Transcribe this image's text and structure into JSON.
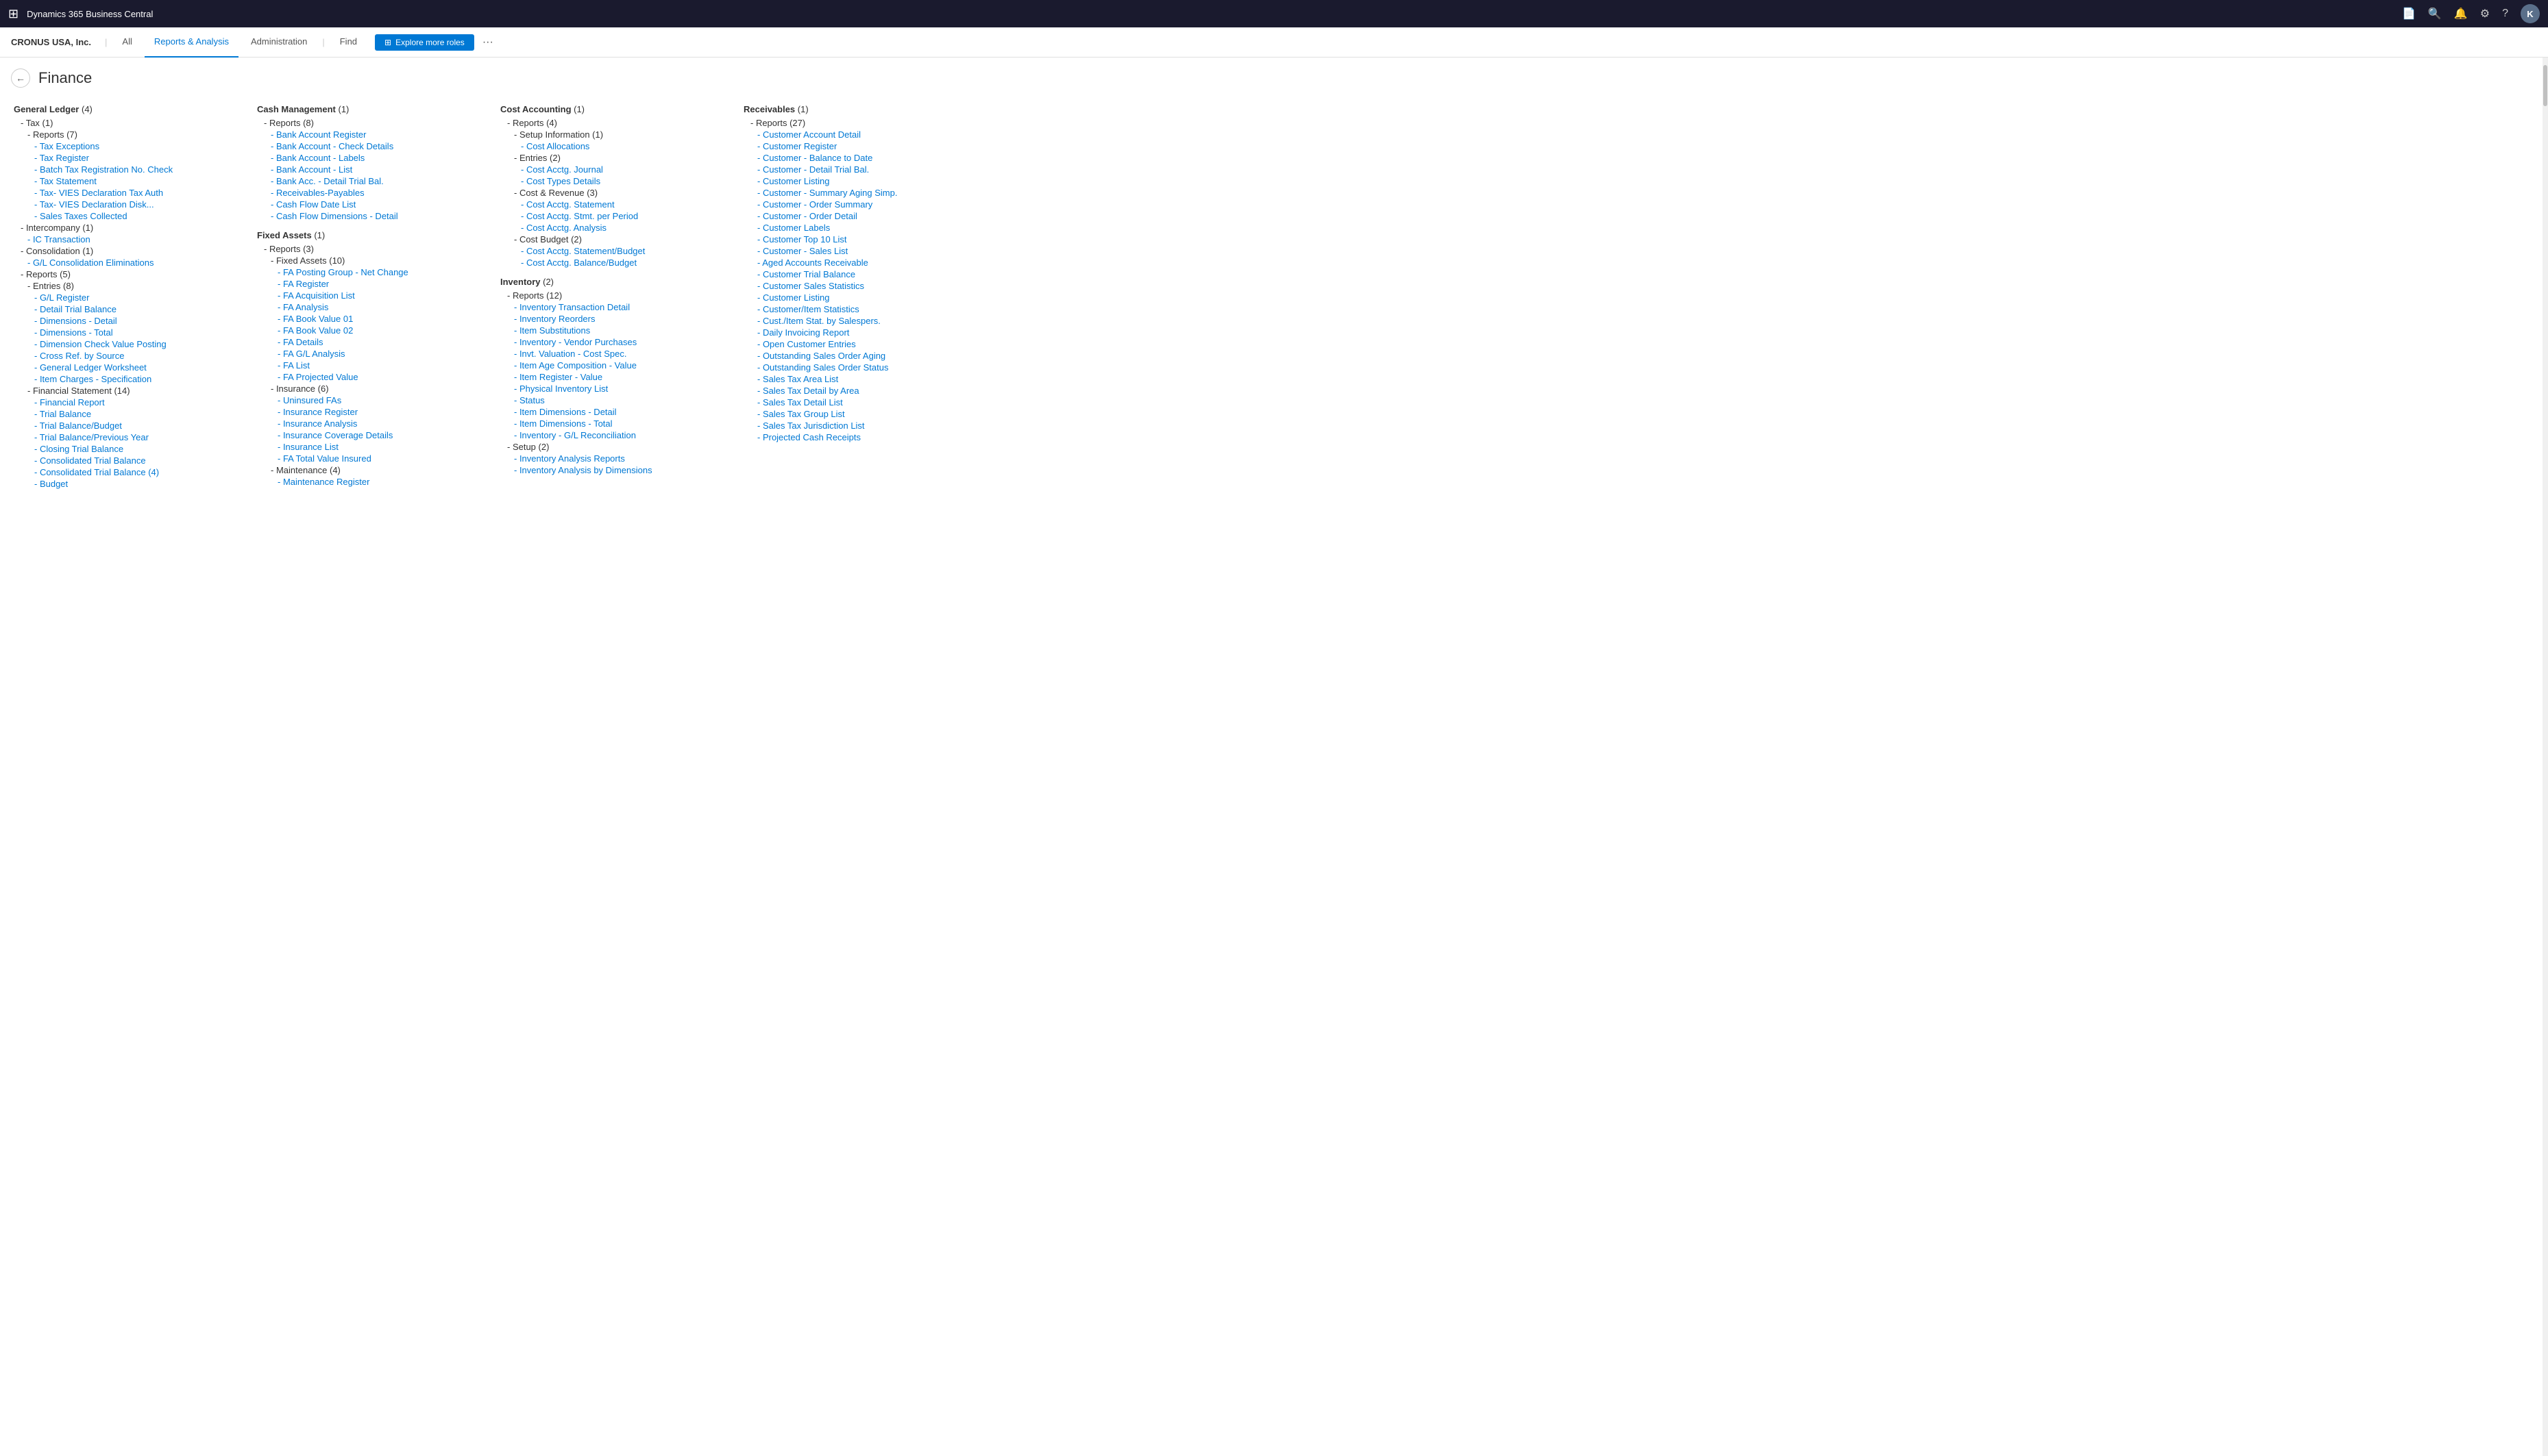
{
  "app": {
    "title": "Dynamics 365 Business Central",
    "avatar_initials": "K"
  },
  "company": "CRONUS USA, Inc.",
  "nav_tabs": [
    {
      "label": "All",
      "active": false
    },
    {
      "label": "Reports & Analysis",
      "active": true
    },
    {
      "label": "Administration",
      "active": false
    },
    {
      "label": "Find",
      "active": false
    }
  ],
  "explore_btn": "Explore more roles",
  "page_title": "Finance",
  "columns": [
    {
      "id": "col1",
      "sections": [
        {
          "header": "General Ledger",
          "count": "(4)",
          "items": [
            {
              "type": "plain",
              "indent": 1,
              "text": "- Tax (1)"
            },
            {
              "type": "plain",
              "indent": 2,
              "text": "- Reports (7)"
            },
            {
              "type": "link",
              "indent": 3,
              "text": "- Tax Exceptions"
            },
            {
              "type": "link",
              "indent": 3,
              "text": "- Tax Register"
            },
            {
              "type": "link",
              "indent": 3,
              "text": "- Batch Tax Registration No. Check"
            },
            {
              "type": "link",
              "indent": 3,
              "text": "- Tax Statement"
            },
            {
              "type": "link",
              "indent": 3,
              "text": "- Tax- VIES Declaration Tax Auth"
            },
            {
              "type": "link",
              "indent": 3,
              "text": "- Tax- VIES Declaration Disk..."
            },
            {
              "type": "link",
              "indent": 3,
              "text": "- Sales Taxes Collected"
            },
            {
              "type": "plain",
              "indent": 1,
              "text": "- Intercompany (1)"
            },
            {
              "type": "link",
              "indent": 2,
              "text": "- IC Transaction"
            },
            {
              "type": "plain",
              "indent": 1,
              "text": "- Consolidation (1)"
            },
            {
              "type": "link",
              "indent": 2,
              "text": "- G/L Consolidation Eliminations"
            },
            {
              "type": "plain",
              "indent": 1,
              "text": "- Reports (5)"
            },
            {
              "type": "plain",
              "indent": 2,
              "text": "- Entries (8)"
            },
            {
              "type": "link",
              "indent": 3,
              "text": "- G/L Register"
            },
            {
              "type": "link",
              "indent": 3,
              "text": "- Detail Trial Balance"
            },
            {
              "type": "link",
              "indent": 3,
              "text": "- Dimensions - Detail"
            },
            {
              "type": "link",
              "indent": 3,
              "text": "- Dimensions - Total"
            },
            {
              "type": "link",
              "indent": 3,
              "text": "- Dimension Check Value Posting"
            },
            {
              "type": "link",
              "indent": 3,
              "text": "- Cross Ref. by Source"
            },
            {
              "type": "link",
              "indent": 3,
              "text": "- General Ledger Worksheet"
            },
            {
              "type": "link",
              "indent": 3,
              "text": "- Item Charges - Specification"
            },
            {
              "type": "plain",
              "indent": 2,
              "text": "- Financial Statement (14)"
            },
            {
              "type": "link",
              "indent": 3,
              "text": "- Financial Report"
            },
            {
              "type": "link",
              "indent": 3,
              "text": "- Trial Balance"
            },
            {
              "type": "link",
              "indent": 3,
              "text": "- Trial Balance/Budget"
            },
            {
              "type": "link",
              "indent": 3,
              "text": "- Trial Balance/Previous Year"
            },
            {
              "type": "link",
              "indent": 3,
              "text": "- Closing Trial Balance"
            },
            {
              "type": "link",
              "indent": 3,
              "text": "- Consolidated Trial Balance"
            },
            {
              "type": "link",
              "indent": 3,
              "text": "- Consolidated Trial Balance (4)"
            },
            {
              "type": "link",
              "indent": 3,
              "text": "- Budget"
            }
          ]
        }
      ]
    },
    {
      "id": "col2",
      "sections": [
        {
          "header": "Cash Management",
          "count": "(1)",
          "items": [
            {
              "type": "plain",
              "indent": 1,
              "text": "- Reports (8)"
            },
            {
              "type": "link",
              "indent": 2,
              "text": "- Bank Account Register"
            },
            {
              "type": "link",
              "indent": 2,
              "text": "- Bank Account - Check Details"
            },
            {
              "type": "link",
              "indent": 2,
              "text": "- Bank Account - Labels"
            },
            {
              "type": "link",
              "indent": 2,
              "text": "- Bank Account - List"
            },
            {
              "type": "link",
              "indent": 2,
              "text": "- Bank Acc. - Detail Trial Bal."
            },
            {
              "type": "link",
              "indent": 2,
              "text": "- Receivables-Payables"
            },
            {
              "type": "link",
              "indent": 2,
              "text": "- Cash Flow Date List"
            },
            {
              "type": "link",
              "indent": 2,
              "text": "- Cash Flow Dimensions - Detail"
            }
          ]
        },
        {
          "header": "Fixed Assets",
          "count": "(1)",
          "items": [
            {
              "type": "plain",
              "indent": 1,
              "text": "- Reports (3)"
            },
            {
              "type": "plain",
              "indent": 2,
              "text": "- Fixed Assets (10)"
            },
            {
              "type": "link",
              "indent": 3,
              "text": "- FA Posting Group - Net Change"
            },
            {
              "type": "link",
              "indent": 3,
              "text": "- FA Register"
            },
            {
              "type": "link",
              "indent": 3,
              "text": "- FA Acquisition List"
            },
            {
              "type": "link",
              "indent": 3,
              "text": "- FA Analysis"
            },
            {
              "type": "link",
              "indent": 3,
              "text": "- FA Book Value 01"
            },
            {
              "type": "link",
              "indent": 3,
              "text": "- FA Book Value 02"
            },
            {
              "type": "link",
              "indent": 3,
              "text": "- FA Details"
            },
            {
              "type": "link",
              "indent": 3,
              "text": "- FA G/L Analysis"
            },
            {
              "type": "link",
              "indent": 3,
              "text": "- FA List"
            },
            {
              "type": "link",
              "indent": 3,
              "text": "- FA Projected Value"
            },
            {
              "type": "plain",
              "indent": 2,
              "text": "- Insurance (6)"
            },
            {
              "type": "link",
              "indent": 3,
              "text": "- Uninsured FAs"
            },
            {
              "type": "link",
              "indent": 3,
              "text": "- Insurance Register"
            },
            {
              "type": "link",
              "indent": 3,
              "text": "- Insurance Analysis"
            },
            {
              "type": "link",
              "indent": 3,
              "text": "- Insurance Coverage Details"
            },
            {
              "type": "link",
              "indent": 3,
              "text": "- Insurance List"
            },
            {
              "type": "link",
              "indent": 3,
              "text": "- FA Total Value Insured"
            },
            {
              "type": "plain",
              "indent": 2,
              "text": "- Maintenance (4)"
            },
            {
              "type": "link",
              "indent": 3,
              "text": "- Maintenance Register"
            }
          ]
        }
      ]
    },
    {
      "id": "col3",
      "sections": [
        {
          "header": "Cost Accounting",
          "count": "(1)",
          "items": [
            {
              "type": "plain",
              "indent": 1,
              "text": "- Reports (4)"
            },
            {
              "type": "plain",
              "indent": 2,
              "text": "- Setup Information (1)"
            },
            {
              "type": "link",
              "indent": 3,
              "text": "- Cost Allocations"
            },
            {
              "type": "plain",
              "indent": 2,
              "text": "- Entries (2)"
            },
            {
              "type": "link",
              "indent": 3,
              "text": "- Cost Acctg. Journal"
            },
            {
              "type": "link",
              "indent": 3,
              "text": "- Cost Types Details"
            },
            {
              "type": "plain",
              "indent": 2,
              "text": "- Cost & Revenue (3)"
            },
            {
              "type": "link",
              "indent": 3,
              "text": "- Cost Acctg. Statement"
            },
            {
              "type": "link",
              "indent": 3,
              "text": "- Cost Acctg. Stmt. per Period"
            },
            {
              "type": "link",
              "indent": 3,
              "text": "- Cost Acctg. Analysis"
            },
            {
              "type": "plain",
              "indent": 2,
              "text": "- Cost Budget (2)"
            },
            {
              "type": "link",
              "indent": 3,
              "text": "- Cost Acctg. Statement/Budget"
            },
            {
              "type": "link",
              "indent": 3,
              "text": "- Cost Acctg. Balance/Budget"
            }
          ]
        },
        {
          "header": "Inventory",
          "count": "(2)",
          "items": [
            {
              "type": "plain",
              "indent": 1,
              "text": "- Reports (12)"
            },
            {
              "type": "link",
              "indent": 2,
              "text": "- Inventory Transaction Detail"
            },
            {
              "type": "link",
              "indent": 2,
              "text": "- Inventory Reorders"
            },
            {
              "type": "link",
              "indent": 2,
              "text": "- Item Substitutions"
            },
            {
              "type": "link",
              "indent": 2,
              "text": "- Inventory - Vendor Purchases"
            },
            {
              "type": "link",
              "indent": 2,
              "text": "- Invt. Valuation - Cost Spec."
            },
            {
              "type": "link",
              "indent": 2,
              "text": "- Item Age Composition - Value"
            },
            {
              "type": "link",
              "indent": 2,
              "text": "- Item Register - Value"
            },
            {
              "type": "link",
              "indent": 2,
              "text": "- Physical Inventory List"
            },
            {
              "type": "link",
              "indent": 2,
              "text": "- Status"
            },
            {
              "type": "link",
              "indent": 2,
              "text": "- Item Dimensions - Detail"
            },
            {
              "type": "link",
              "indent": 2,
              "text": "- Item Dimensions - Total"
            },
            {
              "type": "link",
              "indent": 2,
              "text": "- Inventory - G/L Reconciliation"
            },
            {
              "type": "plain",
              "indent": 1,
              "text": "- Setup (2)"
            },
            {
              "type": "link",
              "indent": 2,
              "text": "- Inventory Analysis Reports"
            },
            {
              "type": "link",
              "indent": 2,
              "text": "- Inventory Analysis by Dimensions"
            }
          ]
        }
      ]
    },
    {
      "id": "col4",
      "sections": [
        {
          "header": "Receivables",
          "count": "(1)",
          "items": [
            {
              "type": "plain",
              "indent": 1,
              "text": "- Reports (27)"
            },
            {
              "type": "link",
              "indent": 2,
              "text": "- Customer Account Detail"
            },
            {
              "type": "link",
              "indent": 2,
              "text": "- Customer Register"
            },
            {
              "type": "link",
              "indent": 2,
              "text": "- Customer - Balance to Date"
            },
            {
              "type": "link",
              "indent": 2,
              "text": "- Customer - Detail Trial Bal."
            },
            {
              "type": "link",
              "indent": 2,
              "text": "- Customer Listing"
            },
            {
              "type": "link",
              "indent": 2,
              "text": "- Customer - Summary Aging Simp."
            },
            {
              "type": "link",
              "indent": 2,
              "text": "- Customer - Order Summary"
            },
            {
              "type": "link",
              "indent": 2,
              "text": "- Customer - Order Detail"
            },
            {
              "type": "link",
              "indent": 2,
              "text": "- Customer Labels"
            },
            {
              "type": "link",
              "indent": 2,
              "text": "- Customer Top 10 List"
            },
            {
              "type": "link",
              "indent": 2,
              "text": "- Customer - Sales List"
            },
            {
              "type": "link",
              "indent": 2,
              "text": "- Aged Accounts Receivable"
            },
            {
              "type": "link",
              "indent": 2,
              "text": "- Customer Trial Balance"
            },
            {
              "type": "link",
              "indent": 2,
              "text": "- Customer Sales Statistics"
            },
            {
              "type": "link",
              "indent": 2,
              "text": "- Customer Listing"
            },
            {
              "type": "link",
              "indent": 2,
              "text": "- Customer/Item Statistics"
            },
            {
              "type": "link",
              "indent": 2,
              "text": "- Cust./Item Stat. by Salespers."
            },
            {
              "type": "link",
              "indent": 2,
              "text": "- Daily Invoicing Report"
            },
            {
              "type": "link",
              "indent": 2,
              "text": "- Open Customer Entries"
            },
            {
              "type": "link",
              "indent": 2,
              "text": "- Outstanding Sales Order Aging"
            },
            {
              "type": "link",
              "indent": 2,
              "text": "- Outstanding Sales Order Status"
            },
            {
              "type": "link",
              "indent": 2,
              "text": "- Sales Tax Area List"
            },
            {
              "type": "link",
              "indent": 2,
              "text": "- Sales Tax Detail by Area"
            },
            {
              "type": "link",
              "indent": 2,
              "text": "- Sales Tax Detail List"
            },
            {
              "type": "link",
              "indent": 2,
              "text": "- Sales Tax Group List"
            },
            {
              "type": "link",
              "indent": 2,
              "text": "- Sales Tax Jurisdiction List"
            },
            {
              "type": "link",
              "indent": 2,
              "text": "- Projected Cash Receipts"
            }
          ]
        }
      ]
    }
  ]
}
